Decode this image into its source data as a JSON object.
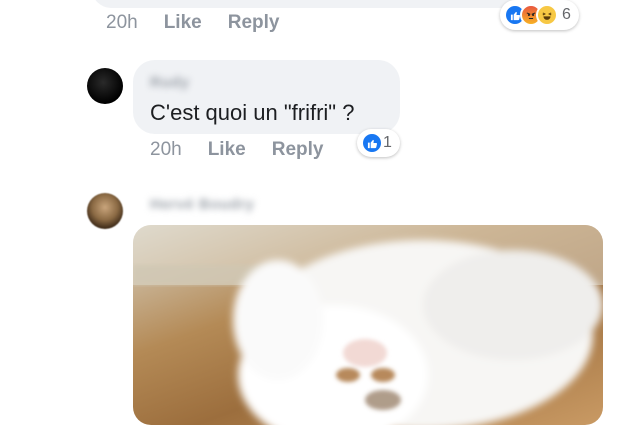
{
  "comment_top": {
    "time": "20h",
    "like_label": "Like",
    "reply_label": "Reply",
    "reactions": [
      "like-icon",
      "angry-icon",
      "haha-icon"
    ],
    "reaction_count": "6"
  },
  "comment_2": {
    "author": "Rudy",
    "text": "C'est quoi un \"frifri\" ?",
    "time": "20h",
    "like_label": "Like",
    "reply_label": "Reply",
    "reactions": [
      "like-icon"
    ],
    "reaction_count": "1"
  },
  "comment_3": {
    "author": "Hervé Boudry",
    "media": "cat-gif-image"
  },
  "colors": {
    "bubble": "#f0f2f5",
    "like_blue": "#1877f2",
    "meta_text": "#8d949e"
  }
}
